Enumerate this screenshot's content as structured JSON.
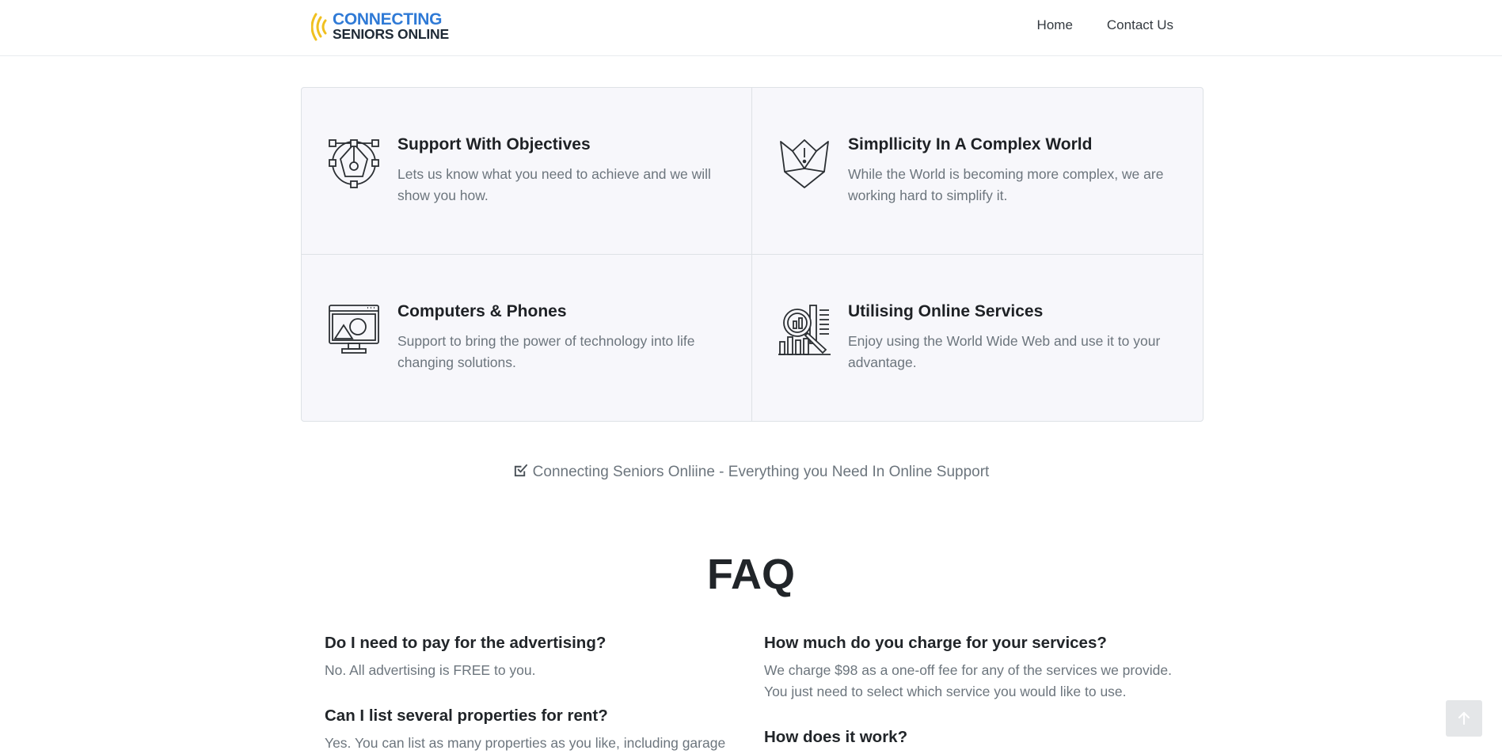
{
  "brand": {
    "line1": "CONNECTING",
    "line2": "SENIORS ONLINE",
    "icon": "signal-waves-icon",
    "colors": {
      "blue": "#2f7ad6",
      "yellow": "#f0c020",
      "dark": "#1f2a36"
    }
  },
  "nav": {
    "items": [
      {
        "label": "Home"
      },
      {
        "label": "Contact Us"
      }
    ]
  },
  "features": [
    {
      "icon": "pen-tool-icon",
      "title": "Support With Objectives",
      "desc": "Lets us know what you need to achieve and we will show you how."
    },
    {
      "icon": "fox-logo-icon",
      "title": "Simpllicity In A Complex World",
      "desc": "While the World is becoming more complex, we are working hard to simplify it."
    },
    {
      "icon": "computer-monitor-icon",
      "title": "Computers & Phones",
      "desc": "Support to bring the power of technology into life changing solutions."
    },
    {
      "icon": "search-analytics-icon",
      "title": "Utilising Online Services",
      "desc": "Enjoy using the World Wide Web and use it to your advantage."
    }
  ],
  "tagline": {
    "icon": "check-square-icon",
    "text": "Connecting Seniors Onliine - Everything you Need In Online Support"
  },
  "faq": {
    "title": "FAQ",
    "left": [
      {
        "q": "Do I need to pay for the advertising?",
        "a": "No. All advertising is FREE to you."
      },
      {
        "q": "Can I list several properties for rent?",
        "a": "Yes. You can list as many properties as you like, including garage"
      }
    ],
    "right": [
      {
        "q": "How much do you charge for your services?",
        "a": "We charge $98 as a one-off fee for any of the services we provide. You just need to select which service you would like to use."
      },
      {
        "q": "How does it work?",
        "a": ""
      }
    ]
  },
  "scroll_top": {
    "icon": "arrow-up-icon"
  }
}
